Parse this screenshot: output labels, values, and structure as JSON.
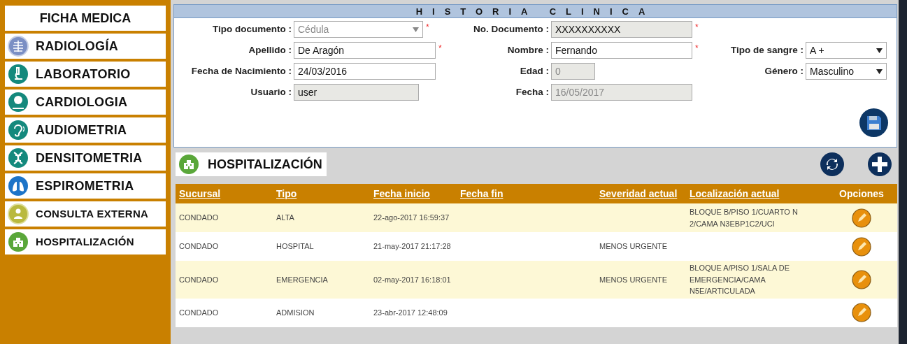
{
  "sidebar": {
    "title": "FICHA MEDICA",
    "items": [
      {
        "label": "RADIOLOGÍA"
      },
      {
        "label": "LABORATORIO"
      },
      {
        "label": "CARDIOLOGIA"
      },
      {
        "label": "AUDIOMETRIA"
      },
      {
        "label": "DENSITOMETRIA"
      },
      {
        "label": "ESPIROMETRIA"
      },
      {
        "label": "CONSULTA EXTERNA"
      },
      {
        "label": "HOSPITALIZACIÓN"
      }
    ]
  },
  "form": {
    "title": "HISTORIA CLINICA",
    "rows": [
      [
        {
          "label": "Tipo documento :",
          "kind": "select",
          "value": "Cédula",
          "disabled": true,
          "readonly": false,
          "required_mark": "*"
        },
        {
          "label": "No. Documento :",
          "kind": "text",
          "value": "XXXXXXXXXX",
          "disabled": false,
          "readonly": true,
          "required_mark": "*"
        }
      ],
      [
        {
          "label": "Apellido :",
          "kind": "text",
          "value": "De Aragón",
          "disabled": false,
          "readonly": false,
          "required_mark": "*"
        },
        {
          "label": "Nombre :",
          "kind": "text",
          "value": "Fernando",
          "disabled": false,
          "readonly": false,
          "required_mark": "*"
        },
        {
          "label": "Tipo de sangre :",
          "kind": "select",
          "value": "A +",
          "disabled": false,
          "readonly": false
        }
      ],
      [
        {
          "label": "Fecha de Nacimiento :",
          "kind": "text",
          "value": "24/03/2016",
          "disabled": false,
          "readonly": false
        },
        {
          "label": "Edad :",
          "kind": "text",
          "value": "0",
          "disabled": true,
          "readonly": true
        },
        {
          "label": "Género :",
          "kind": "select",
          "value": "Masculino",
          "disabled": false,
          "readonly": false
        }
      ],
      [
        {
          "label": "Usuario :",
          "kind": "text",
          "value": "user",
          "disabled": false,
          "readonly": true
        },
        {
          "label": "Fecha :",
          "kind": "text",
          "value": "16/05/2017",
          "disabled": true,
          "readonly": true
        }
      ]
    ]
  },
  "section": {
    "title": "HOSPITALIZACIÓN"
  },
  "table": {
    "columns": [
      {
        "label": "Sucursal",
        "kind": "link"
      },
      {
        "label": "Tipo",
        "kind": "link"
      },
      {
        "label": "Fecha inicio",
        "kind": "link"
      },
      {
        "label": "Fecha fin",
        "kind": "link"
      },
      {
        "label": "Severidad actual",
        "kind": "link"
      },
      {
        "label": "Localización actual",
        "kind": "link"
      },
      {
        "label": "Opciones",
        "kind": "plain"
      }
    ],
    "rows": [
      [
        "CONDADO",
        "ALTA",
        "22-ago-2017 16:59:37",
        "",
        "",
        "BLOQUE B/PISO 1/CUARTO N 2/CAMA N3EBP1C2/UCI"
      ],
      [
        "CONDADO",
        "HOSPITAL",
        "21-may-2017 21:17:28",
        "",
        "MENOS URGENTE",
        ""
      ],
      [
        "CONDADO",
        "EMERGENCIA",
        "02-may-2017 16:18:01",
        "",
        "MENOS URGENTE",
        "BLOQUE A/PISO 1/SALA DE EMERGENCIA/CAMA N5E/ARTICULADA"
      ],
      [
        "CONDADO",
        "ADMISION",
        "23-abr-2017 12:48:09",
        "",
        "",
        ""
      ]
    ]
  }
}
